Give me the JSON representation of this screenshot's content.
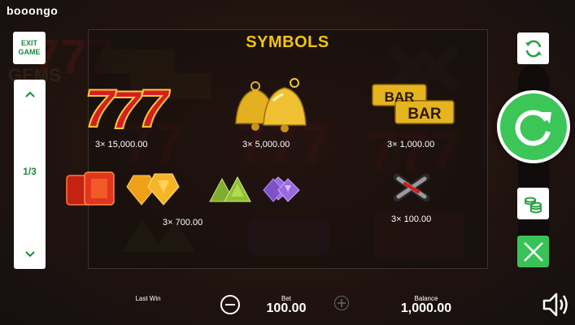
{
  "brand": {
    "logo": "booongo"
  },
  "nav": {
    "exit_label_1": "EXIT",
    "exit_label_2": "GAME",
    "page_indicator": "1/3"
  },
  "paytable": {
    "title": "SYMBOLS",
    "payouts": {
      "sevens": "3×  15,000.00",
      "bells": "3×  5,000.00",
      "bars": "3×  1,000.00",
      "gems": "3×  700.00",
      "x": "3×  100.00"
    },
    "bar_text": "BAR"
  },
  "footer": {
    "last_win_label": "Last Win",
    "bet_label": "Bet",
    "bet_value": "100.00",
    "balance_label": "Balance",
    "balance_value": "1,000.00"
  },
  "icons": {
    "refresh": "refresh-icon",
    "spin": "spin-icon",
    "coins": "coins-icon",
    "close": "close-icon",
    "sound": "speaker-icon",
    "minus": "minus-icon",
    "plus": "plus-icon",
    "up": "chevron-up-icon",
    "down": "chevron-down-icon"
  },
  "colors": {
    "accent_green": "#3bc657",
    "title_gold": "#f2c511",
    "background": "#181210"
  }
}
